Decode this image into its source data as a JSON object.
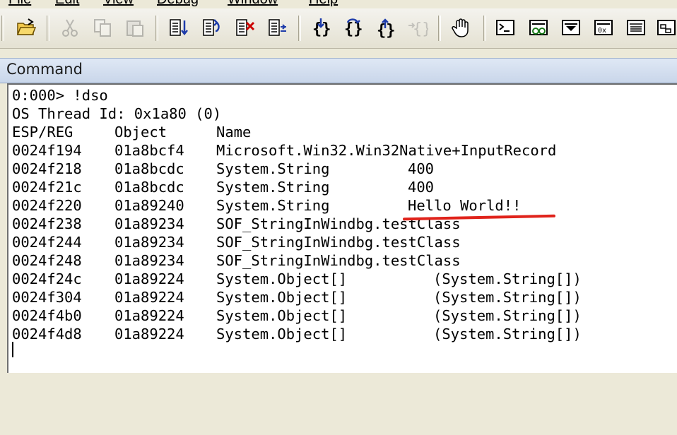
{
  "menu": [
    "File",
    "Edit",
    "View",
    "Debug",
    "Window",
    "Help"
  ],
  "toolbar": {
    "buttons": [
      {
        "name": "open-icon",
        "enabled": true
      },
      {
        "name": "cut-icon",
        "enabled": false
      },
      {
        "name": "copy-icon",
        "enabled": false
      },
      {
        "name": "paste-icon",
        "enabled": false
      },
      {
        "name": "go-icon",
        "enabled": true
      },
      {
        "name": "restart-icon",
        "enabled": true
      },
      {
        "name": "stop-debugging-icon",
        "enabled": true
      },
      {
        "name": "detach-icon",
        "enabled": true
      },
      {
        "name": "step-into-icon",
        "enabled": true
      },
      {
        "name": "step-over-icon",
        "enabled": true
      },
      {
        "name": "step-out-icon",
        "enabled": true
      },
      {
        "name": "run-to-cursor-icon",
        "enabled": false
      },
      {
        "name": "break-hand-icon",
        "enabled": true
      },
      {
        "name": "command-window-icon",
        "enabled": true
      },
      {
        "name": "watch-window-icon",
        "enabled": true
      },
      {
        "name": "locals-window-icon",
        "enabled": true
      },
      {
        "name": "registers-window-icon",
        "enabled": true
      },
      {
        "name": "memory-window-icon",
        "enabled": true
      },
      {
        "name": "call-stack-window-icon",
        "enabled": true
      }
    ]
  },
  "command_window": {
    "title": "Command",
    "lines": [
      {
        "c1": "0:000> !dso"
      },
      {
        "c1": "OS Thread Id: 0x1a80 (0)"
      },
      {
        "c1": "ESP/REG",
        "c2": "Object",
        "c3": "Name"
      },
      {
        "c1": "0024f194",
        "c2": "01a8bcf4",
        "c3": "Microsoft.Win32.Win32Native+InputRecord"
      },
      {
        "c1": "0024f218",
        "c2": "01a8bcdc",
        "c3": "System.String",
        "c4": "400"
      },
      {
        "c1": "0024f21c",
        "c2": "01a8bcdc",
        "c3": "System.String",
        "c4": "400"
      },
      {
        "c1": "0024f220",
        "c2": "01a89240",
        "c3": "System.String",
        "c4": "Hello World!!"
      },
      {
        "c1": "0024f238",
        "c2": "01a89234",
        "c3": "SOF_StringInWindbg.testClass"
      },
      {
        "c1": "0024f244",
        "c2": "01a89234",
        "c3": "SOF_StringInWindbg.testClass"
      },
      {
        "c1": "0024f248",
        "c2": "01a89234",
        "c3": "SOF_StringInWindbg.testClass"
      },
      {
        "c1": "0024f24c",
        "c2": "01a89224",
        "c3": "System.Object[]",
        "c4b": "(System.String[])"
      },
      {
        "c1": "0024f304",
        "c2": "01a89224",
        "c3": "System.Object[]",
        "c4b": "(System.String[])"
      },
      {
        "c1": "0024f4b0",
        "c2": "01a89224",
        "c3": "System.Object[]",
        "c4b": "(System.String[])"
      },
      {
        "c1": "0024f4d8",
        "c2": "01a89224",
        "c3": "System.Object[]",
        "c4b": "(System.String[])"
      }
    ]
  },
  "annotation": {
    "color": "#e0231b"
  }
}
